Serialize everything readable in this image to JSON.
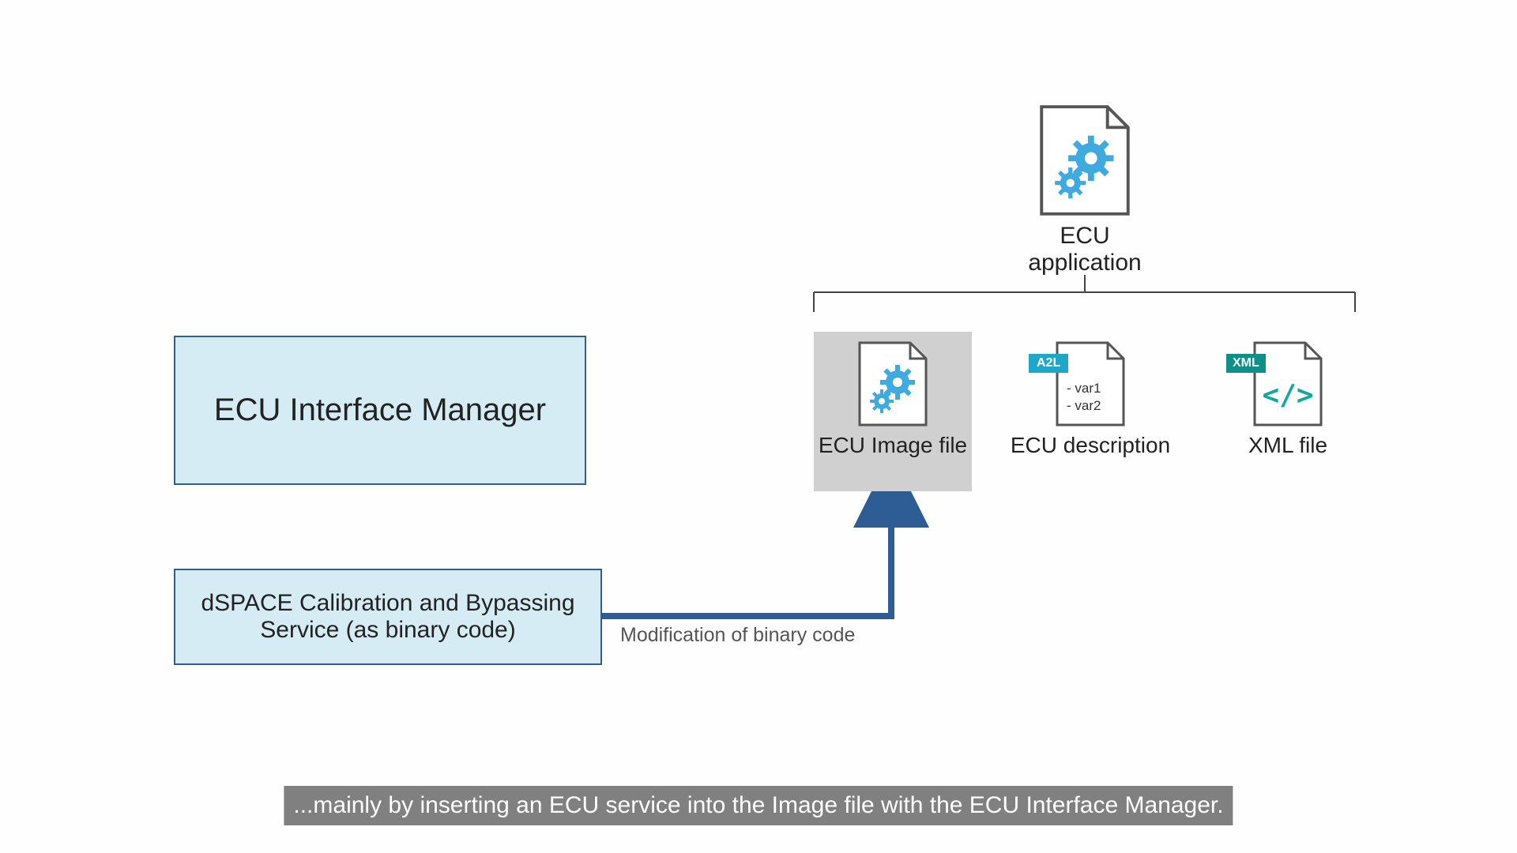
{
  "boxes": {
    "ecu_interface_manager": "ECU Interface Manager",
    "dspace_service": "dSPACE Calibration and Bypassing Service (as binary code)"
  },
  "top_file": {
    "label": "ECU application"
  },
  "files": {
    "image_file": {
      "label": "ECU Image file"
    },
    "ecu_description": {
      "label": "ECU description",
      "badge": "A2L",
      "lines": [
        "- var1",
        "- var2"
      ]
    },
    "xml_file": {
      "label": "XML file",
      "badge": "XML"
    }
  },
  "arrow_label": "Modification of binary code",
  "caption": "...mainly by inserting an ECU service into the Image file with the ECU Interface Manager.",
  "colors": {
    "box_fill": "#d5ecf5",
    "box_border": "#2e5c94",
    "arrow": "#2e5c94",
    "gear": "#3fa9e0",
    "a2l_badge": "#1fa7c9",
    "xml_badge": "#0f8f8a",
    "xml_code": "#13a89c",
    "caption_bg": "#808080"
  }
}
